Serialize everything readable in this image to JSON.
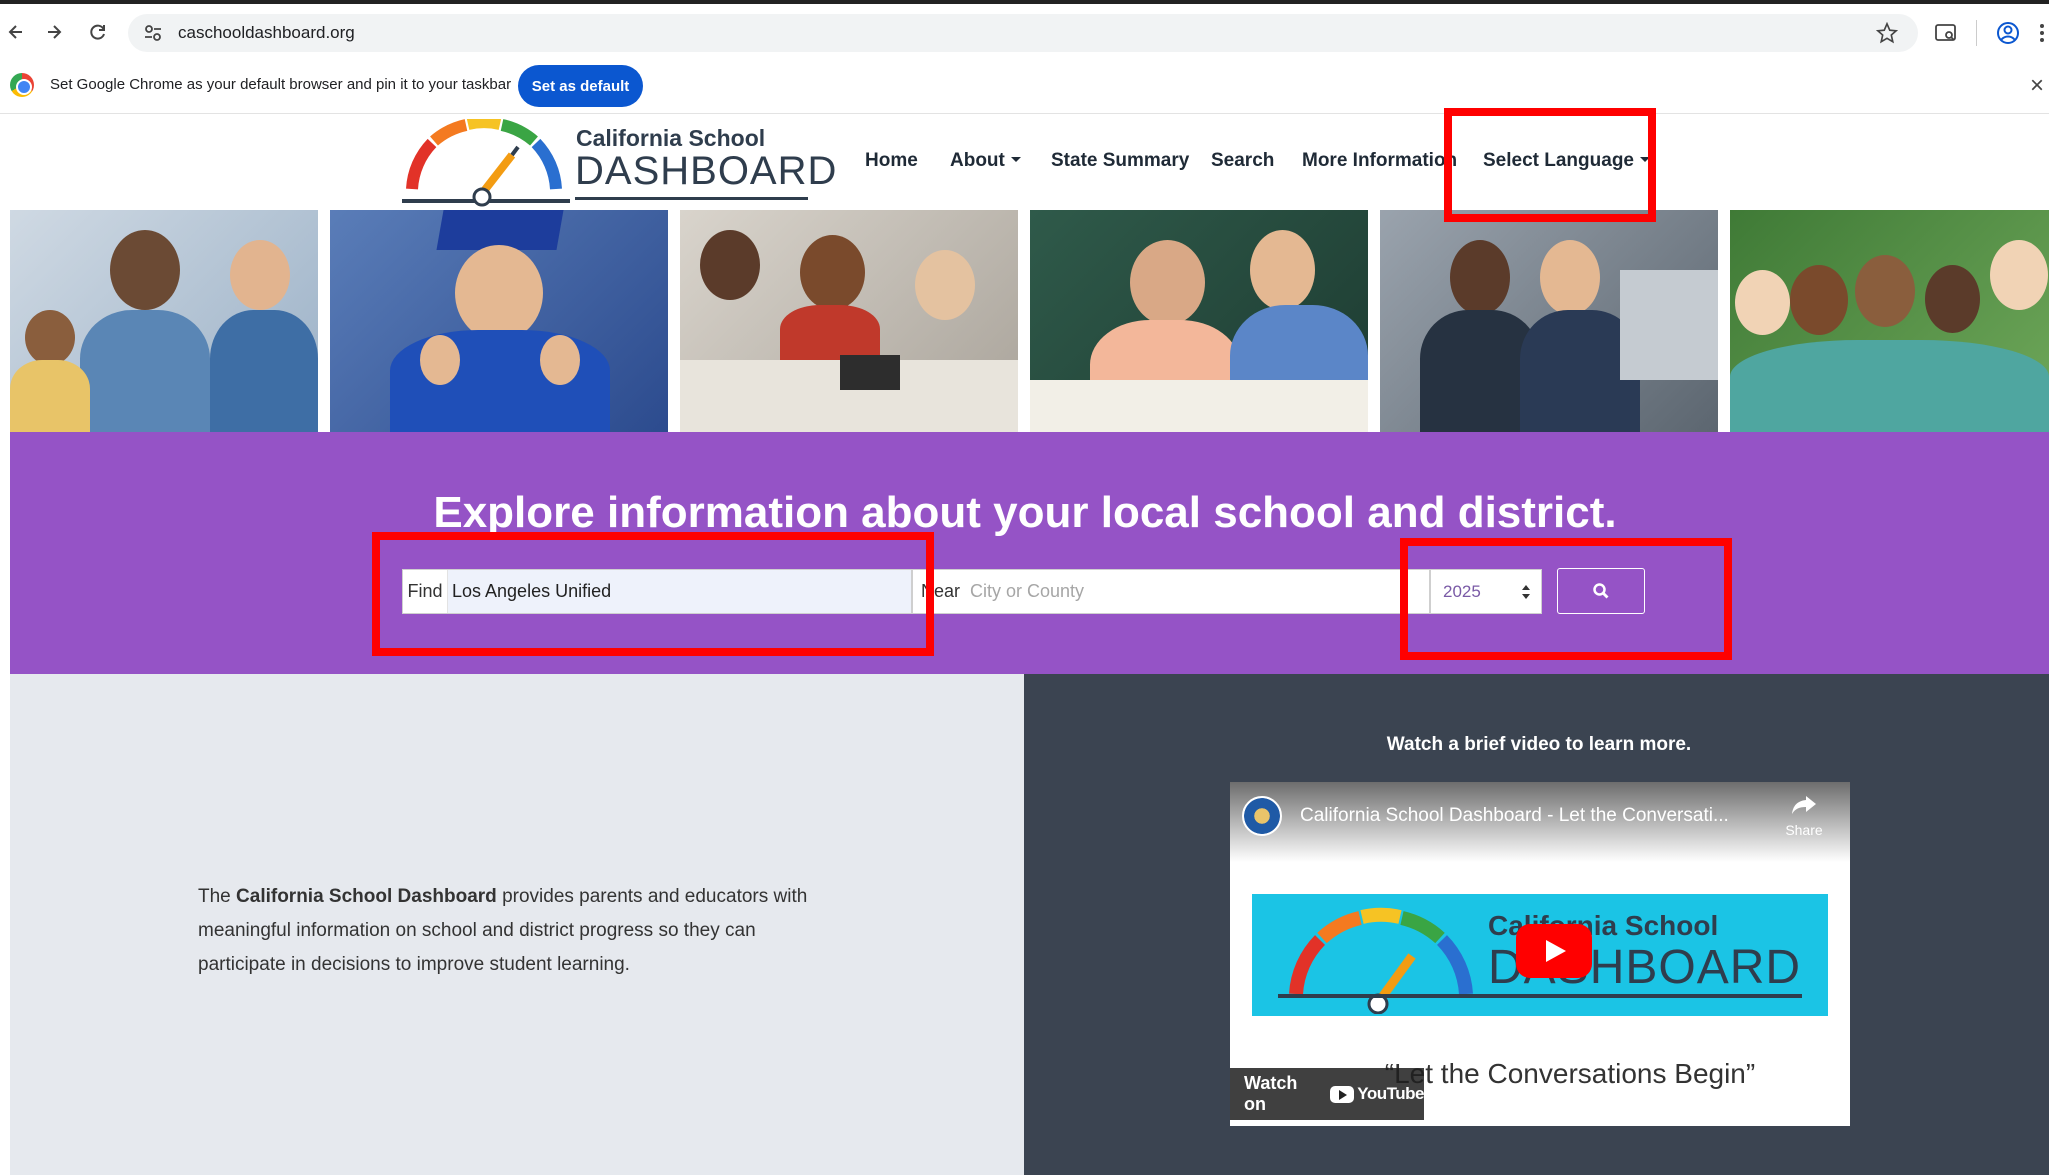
{
  "browser": {
    "url": "caschooldashboard.org",
    "infobar_text": "Set Google Chrome as your default browser and pin it to your taskbar",
    "default_button": "Set as default",
    "close_glyph": "×"
  },
  "logo": {
    "line1": "California School",
    "line2": "DASHBOARD"
  },
  "nav": {
    "home": "Home",
    "about": "About",
    "state_summary": "State Summary",
    "search": "Search",
    "more_information": "More Information",
    "select_language": "Select Language"
  },
  "hero": {
    "headline": "Explore information about your local school and district."
  },
  "search_form": {
    "find_label": "Find",
    "find_value": "Los Angeles Unified",
    "near_label": "Near",
    "near_placeholder": "City or County",
    "year": "2025"
  },
  "intro": {
    "pre": "The ",
    "bold": "California School Dashboard",
    "post": " provides parents and educators with meaningful information on school and district progress so they can participate in decisions to improve student learning."
  },
  "video": {
    "heading": "Watch a brief video to learn more.",
    "title": "California School Dashboard - Let the Conversati...",
    "share": "Share",
    "thumb_line1": "California School",
    "thumb_line2": "DASHBOARD",
    "quote": "“Let the Conversations Begin”",
    "watch_on": "Watch on",
    "youtube": "YouTube"
  },
  "colors": {
    "purple_band": "#9553c6",
    "dark_panel": "#3b4451",
    "highlight": "#ff0000",
    "chrome_blue": "#0b57d0"
  },
  "icons": [
    "back-icon",
    "forward-icon",
    "reload-icon",
    "site-settings-icon",
    "star-icon",
    "tab-search-icon",
    "profile-icon",
    "menu-icon",
    "chrome-logo-icon",
    "search-icon",
    "share-icon",
    "play-icon",
    "youtube-icon"
  ]
}
